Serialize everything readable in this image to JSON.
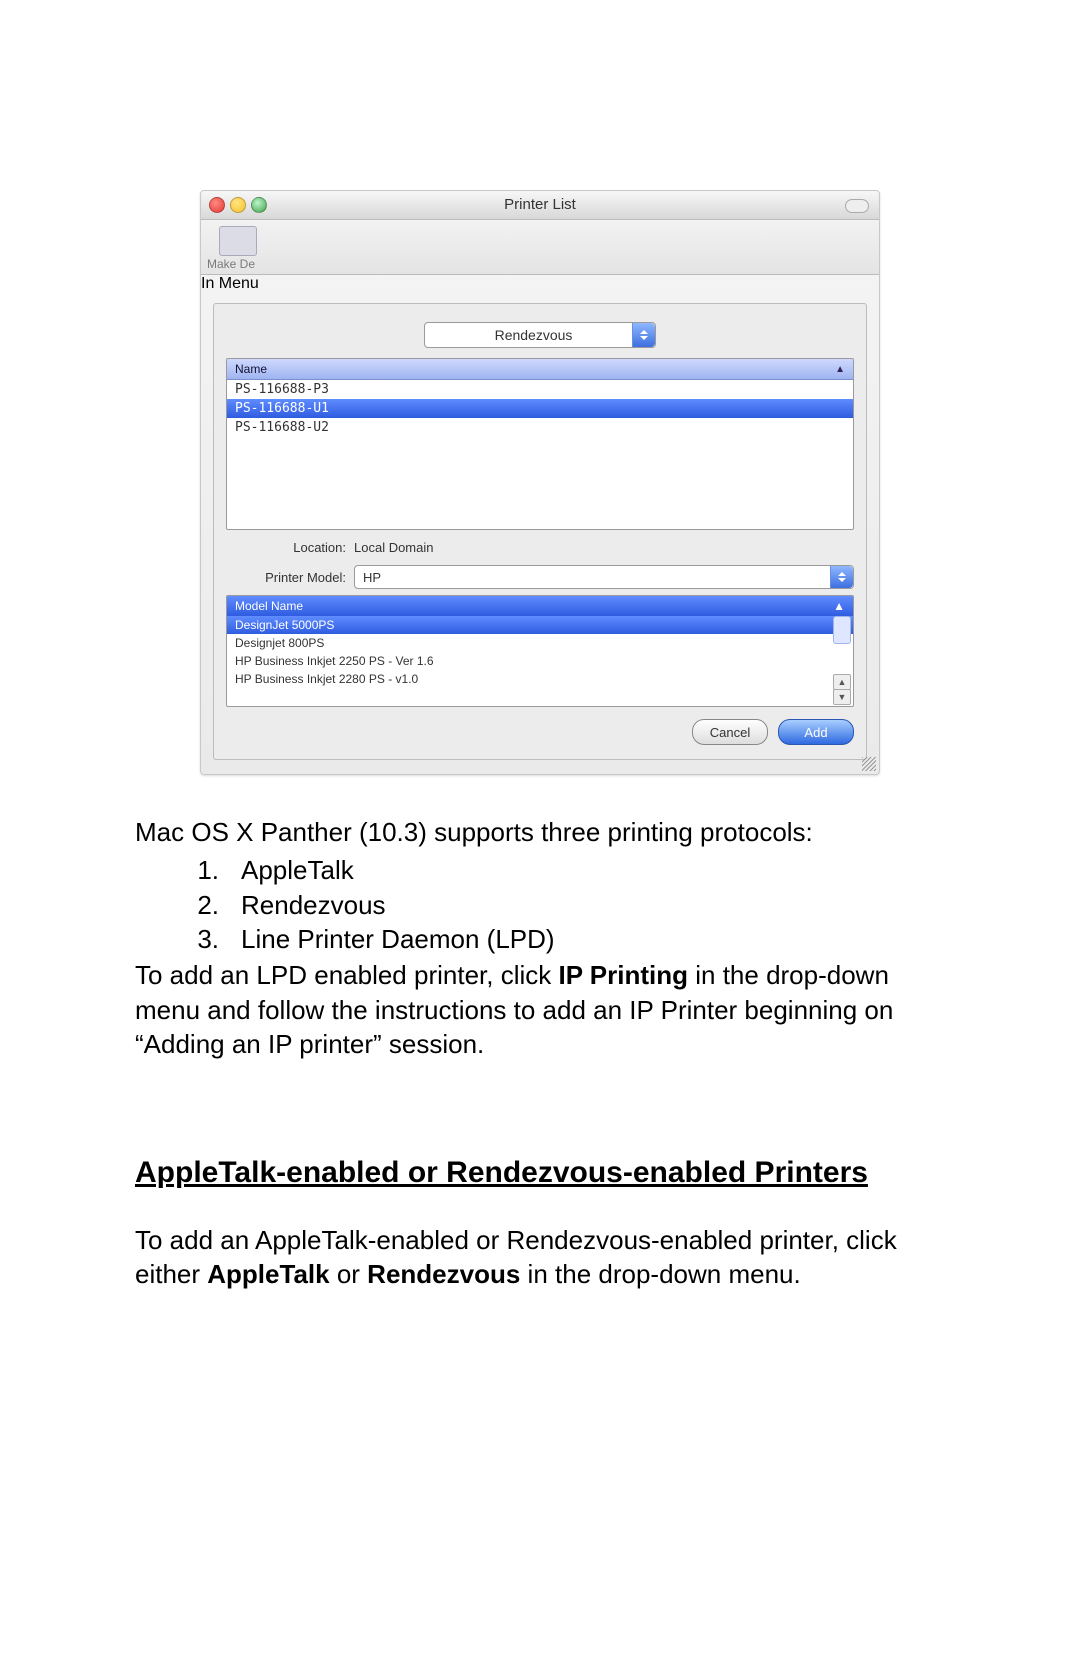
{
  "screenshot": {
    "window_title": "Printer List",
    "toolbar_label": "Make De",
    "sidebar_label": "In Menu",
    "protocol_dropdown": "Rendezvous",
    "name_header": "Name",
    "printers": [
      "PS-116688-P3",
      "PS-116688-U1",
      "PS-116688-U2"
    ],
    "selected_printer_index": 1,
    "location_label": "Location:",
    "location_value": "Local Domain",
    "model_label": "Printer Model:",
    "model_value": "HP",
    "model_header": "Model Name",
    "models": [
      "DesignJet 5000PS",
      "Designjet 800PS",
      "HP Business Inkjet 2250 PS - Ver 1.6",
      "HP Business Inkjet 2280 PS - v1.0"
    ],
    "selected_model_index": 0,
    "cancel": "Cancel",
    "add": "Add"
  },
  "doc": {
    "intro": "Mac OS X Panther (10.3) supports three printing protocols:",
    "items": [
      "AppleTalk",
      "Rendezvous",
      "Line Printer Daemon (LPD)"
    ],
    "para2_a": "To add an LPD enabled printer, click ",
    "para2_bold": "IP Printing",
    "para2_b": " in the drop-down menu and follow the instructions to add an IP Printer beginning on “Adding an IP printer” session.",
    "heading": "AppleTalk-enabled or Rendezvous-enabled Printers",
    "para3_a": "To add an AppleTalk-enabled or Rendezvous-enabled printer, click either ",
    "para3_bold1": "AppleTalk",
    "para3_mid": " or ",
    "para3_bold2": "Rendezvous",
    "para3_b": " in the drop-down menu."
  }
}
